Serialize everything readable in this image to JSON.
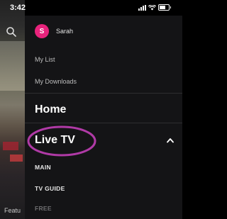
{
  "status_bar": {
    "time": "3:42"
  },
  "background": {
    "feature_text": "Featu"
  },
  "drawer": {
    "profile": {
      "initial": "S",
      "name": "Sarah"
    },
    "items": {
      "my_list": "My List",
      "my_downloads": "My Downloads",
      "home": "Home",
      "live_tv": "Live TV"
    },
    "sub_items": {
      "main": "MAIN",
      "tv_guide": "TV GUIDE",
      "free": "FREE"
    }
  },
  "colors": {
    "avatar": "#e8237c",
    "highlight_circle": "#b03aa6"
  }
}
